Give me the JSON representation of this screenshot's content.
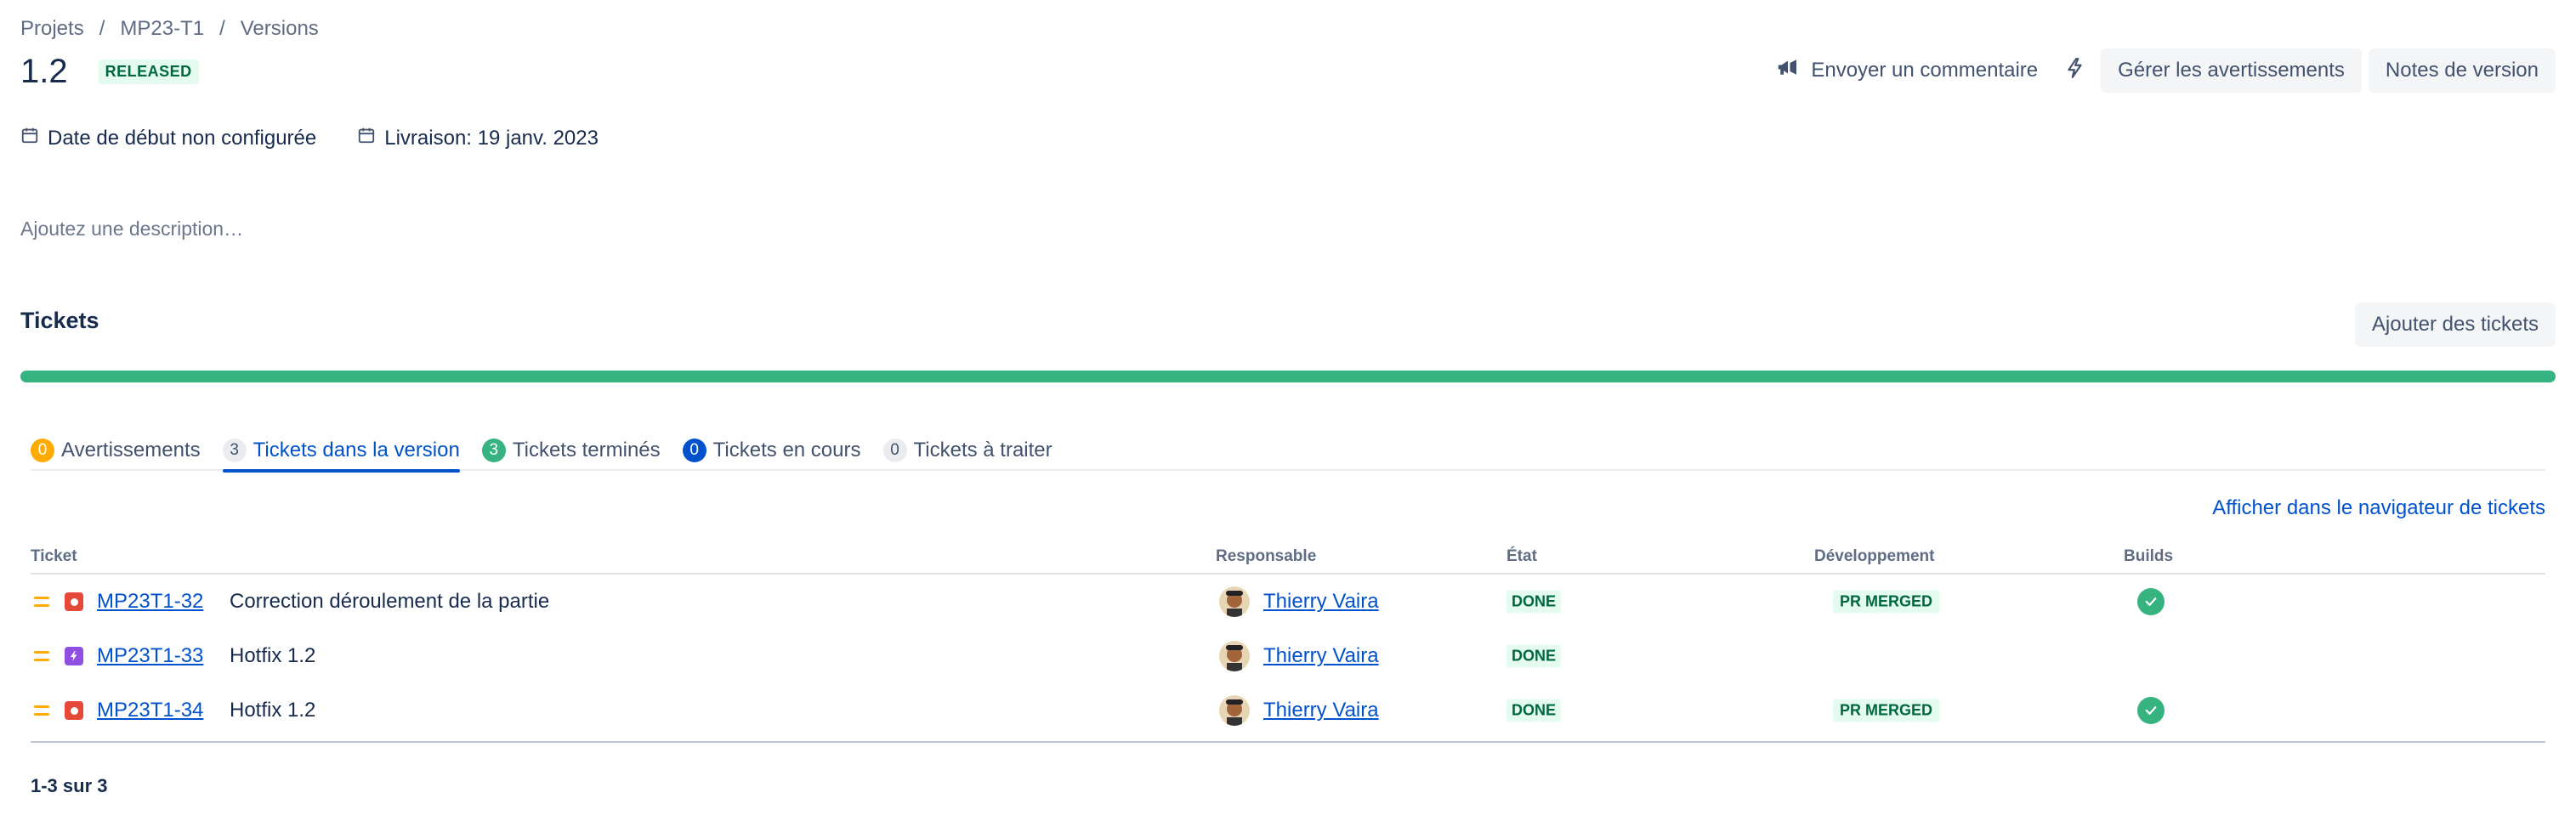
{
  "breadcrumb": [
    "Projets",
    "MP23-T1",
    "Versions"
  ],
  "version": {
    "title": "1.2",
    "status": "RELEASED"
  },
  "actions": {
    "feedback_label": "Envoyer un commentaire",
    "warnings_label": "Gérer les avertissements",
    "release_notes_label": "Notes de version"
  },
  "dates": {
    "start": "Date de début non configurée",
    "release": "Livraison: 19 janv. 2023"
  },
  "description_placeholder": "Ajoutez une description…",
  "tickets": {
    "title": "Tickets",
    "add_label": "Ajouter des tickets",
    "progress_done_fraction": 1.0
  },
  "tabs": [
    {
      "count": "0",
      "label": "Avertissements"
    },
    {
      "count": "3",
      "label": "Tickets dans la version"
    },
    {
      "count": "3",
      "label": "Tickets terminés"
    },
    {
      "count": "0",
      "label": "Tickets en cours"
    },
    {
      "count": "0",
      "label": "Tickets à traiter"
    }
  ],
  "navigator_link": "Afficher dans le navigateur de tickets",
  "table": {
    "headers": {
      "ticket": "Ticket",
      "assignee": "Responsable",
      "state": "État",
      "development": "Développement",
      "builds": "Builds"
    },
    "rows": [
      {
        "key": "MP23T1-32",
        "summary": "Correction déroulement de la partie",
        "assignee": "Thierry Vaira",
        "state": "DONE",
        "dev": "PR MERGED",
        "type": "bug",
        "build_ok": true
      },
      {
        "key": "MP23T1-33",
        "summary": "Hotfix 1.2",
        "assignee": "Thierry Vaira",
        "state": "DONE",
        "dev": "",
        "type": "story",
        "build_ok": false
      },
      {
        "key": "MP23T1-34",
        "summary": "Hotfix 1.2",
        "assignee": "Thierry Vaira",
        "state": "DONE",
        "dev": "PR MERGED",
        "type": "bug",
        "build_ok": true
      }
    ]
  },
  "pager": "1-3 sur 3",
  "colors": {
    "accent": "#0052cc",
    "success": "#36b37e",
    "warning": "#ffab00",
    "bug": "#e5493a",
    "story": "#904ee2"
  }
}
